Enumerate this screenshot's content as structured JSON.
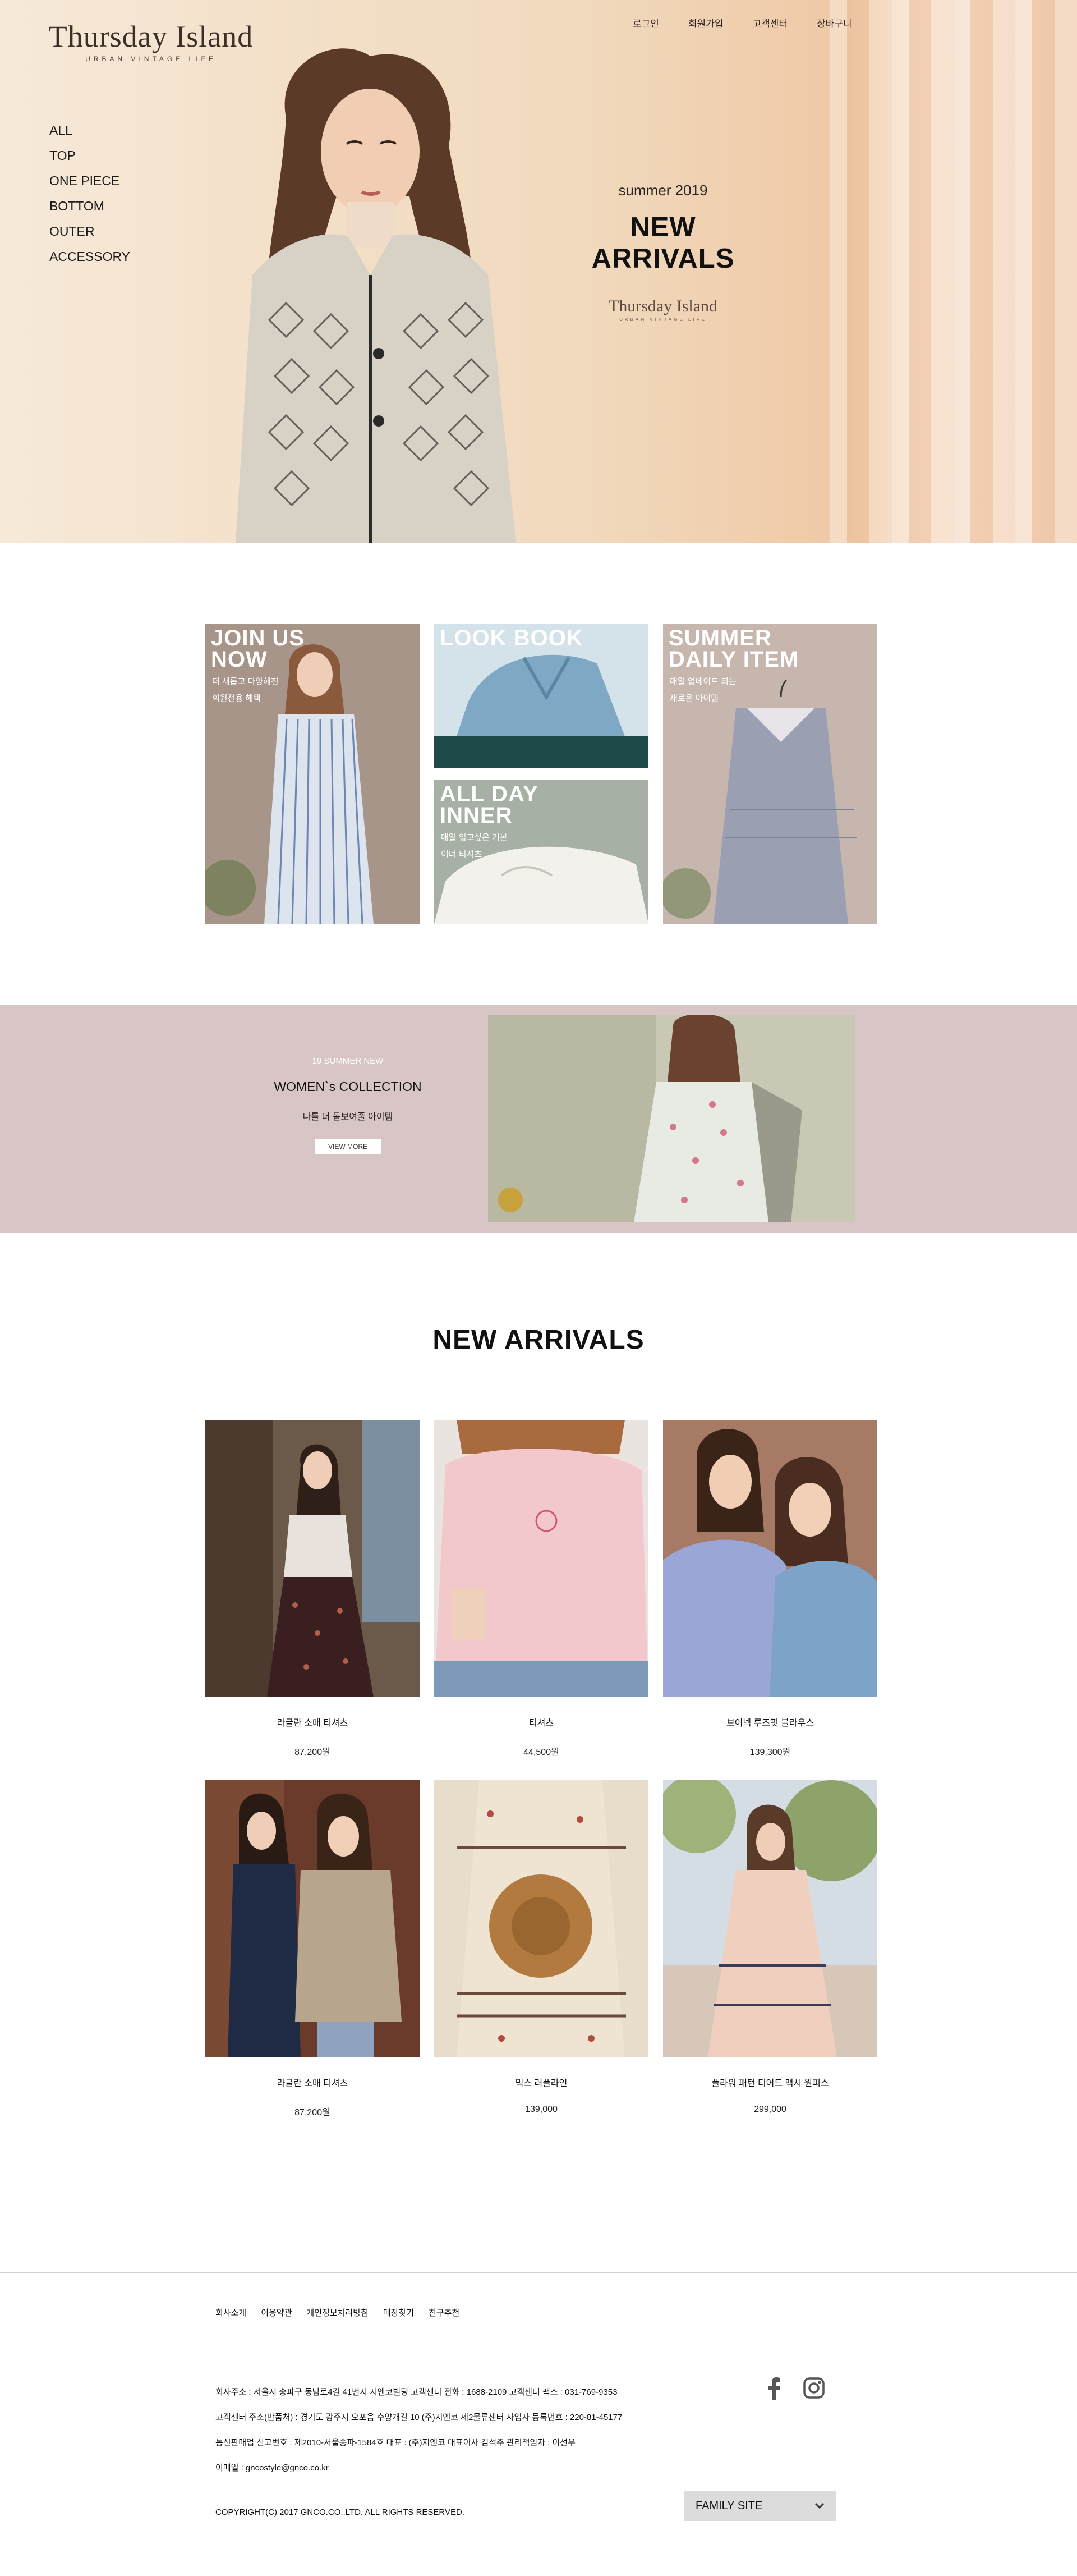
{
  "brand": {
    "name": "Thursday Island",
    "tagline": "URBAN VINTAGE LIFE"
  },
  "top_nav": {
    "login": "로그인",
    "join": "회원가입",
    "support": "고객센터",
    "cart": "장바구니"
  },
  "category_nav": [
    "ALL",
    "TOP",
    "ONE PIECE",
    "BOTTOM",
    "OUTER",
    "ACCESSORY"
  ],
  "hero": {
    "season": "summer 2019",
    "title": "NEW ARRIVALS",
    "brand_name": "Thursday Island",
    "brand_tagline": "URBAN VINTAGE LIFE"
  },
  "promo": {
    "join": {
      "title_1": "JOIN US",
      "title_2": "NOW",
      "sub_1": "더 새롭고 다양해진",
      "sub_2": "회원전용 혜택"
    },
    "lookbook": {
      "title": "LOOK BOOK"
    },
    "allday": {
      "title_1": "ALL DAY",
      "title_2": "INNER",
      "sub_1": "매일 입고싶은 기본",
      "sub_2": "이너 티셔츠"
    },
    "summer": {
      "title_1": "SUMMER",
      "title_2": "DAILY ITEM",
      "sub_1": "매일 업데이트 되는",
      "sub_2": "새로운 아이템"
    }
  },
  "banner": {
    "kicker": "19 SUMMER NEW",
    "title": "WOMEN`s COLLECTION",
    "subtitle": "나를 더 돋보여줄  아이템",
    "button": "VIEW MORE"
  },
  "arrivals": {
    "title": "NEW ARRIVALS",
    "products": [
      {
        "name": "라글란 소매 티셔츠",
        "price": "87,200원"
      },
      {
        "name": "티셔츠",
        "price": "44,500원"
      },
      {
        "name": "브이넥 루즈핏 블라우스",
        "price": "139,300원"
      },
      {
        "name": "라글란 소매 티셔츠",
        "price": "87,200원"
      },
      {
        "name": "믹스 러플라인",
        "price": "139,000"
      },
      {
        "name": "플라워 패턴 티어드 맥시 원피스",
        "price": "299,000"
      }
    ]
  },
  "footer": {
    "links": [
      "회사소개",
      "이용약관",
      "개인정보처리방침",
      "매장찾기",
      "친구추천"
    ],
    "info": [
      "회사주소 : 서울시 송파구 동남로4길 41번지 지엔코빌딩 고객센터 전화 : 1688-2109 고객센터 팩스 : 031-769-9353",
      "고객센터 주소(반품처) : 경기도 광주시 오포읍 수양개길 10 (주)지엔코 제2물류센터 사업자 등록번호 : 220-81-45177",
      "통신판매업 신고번호 : 제2010-서울송파-1584호 대표 : (주)지엔코 대표이사 김석주 관리책임자 : 이선우",
      "이메일 : gncostyle@gnco.co.kr"
    ],
    "copyright": "COPYRIGHT(C) 2017 GNCO.CO.,LTD. ALL RIGHTS RESERVED.",
    "family_site": "FAMILY SITE"
  },
  "icons": {
    "facebook": "facebook-icon",
    "instagram": "instagram-icon",
    "dropdown": "chevron-down-icon"
  }
}
